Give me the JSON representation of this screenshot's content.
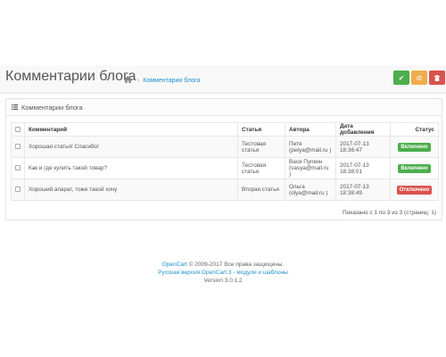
{
  "header": {
    "title": "Комментарии блога",
    "breadcrumb": "Комментарии блога"
  },
  "buttons": {
    "enable": "✔",
    "disable": "⊘",
    "delete": "🗑"
  },
  "panel": {
    "title": "Комментарии блога"
  },
  "table": {
    "columns": [
      "Комментарий",
      "Статья",
      "Автора",
      "Дата добавления",
      "Статус"
    ],
    "rows": [
      {
        "comment": "Хорошая статья! Спасибо!",
        "article": "Тестовая статья",
        "author": "Петя (petya@mail.ru )",
        "date": "2017-07-13 18:36:47",
        "status": "Включено"
      },
      {
        "comment": "Как и где купить такой товар?",
        "article": "Тестовая статья",
        "author": "Вася Пупкин (vasya@mail.ru )",
        "date": "2017-07-13 18:38:01",
        "status": "Включено"
      },
      {
        "comment": "Хороший апарат, тоже такой хочу",
        "article": "Вторая статья",
        "author": "Ольга (olya@mail.ru )",
        "date": "2017-07-13 18:38:49",
        "status": "Отключено"
      }
    ]
  },
  "pagination": {
    "info": "Показано с 1 по 3 из 3 (страниц: 1)"
  },
  "footer": {
    "brand": "OpenCart",
    "copyright": "© 2009-2017 Все права защищены.",
    "russian_version": "Русская версия OpenCart.3 - модули и шаблоны",
    "version": "Version 3.0.1.2"
  },
  "colors": {
    "success": "#4cae4c",
    "warning": "#f0ad4e",
    "danger": "#d9534f",
    "link": "#1e91cf"
  }
}
